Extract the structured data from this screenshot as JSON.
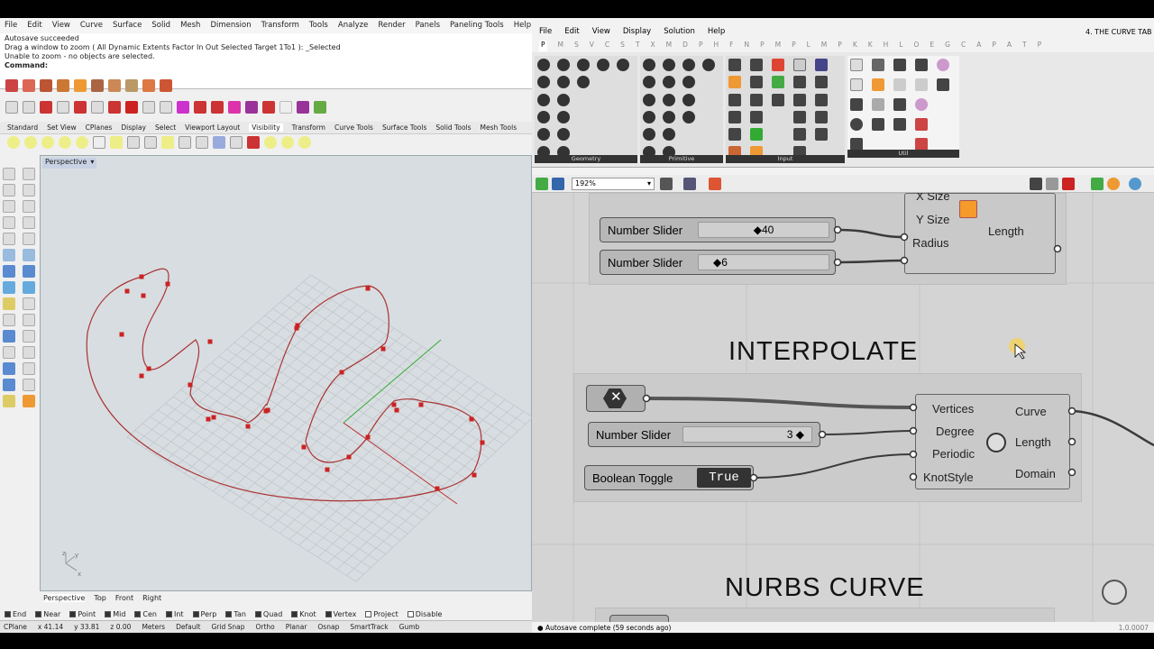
{
  "rhino": {
    "menu": [
      "File",
      "Edit",
      "View",
      "Curve",
      "Surface",
      "Solid",
      "Mesh",
      "Dimension",
      "Transform",
      "Tools",
      "Analyze",
      "Render",
      "Panels",
      "Paneling Tools",
      "Help"
    ],
    "history": [
      "Autosave succeeded",
      "Drag a window to zoom ( All  Dynamic  Extents  Factor  In  Out  Selected  Target  1To1 ): _Selected",
      "Unable to zoom - no objects are selected."
    ],
    "command_label": "Command:",
    "toolbar_tabs": [
      "Standard",
      "Set View",
      "CPlanes",
      "Display",
      "Select",
      "Viewport Layout",
      "Visibility",
      "Transform",
      "Curve Tools",
      "Surface Tools",
      "Solid Tools",
      "Mesh Tools"
    ],
    "active_tab": "Visibility",
    "viewport_title": "Perspective",
    "viewport_tabs": [
      "Perspective",
      "Top",
      "Front",
      "Right"
    ],
    "axis_labels": [
      "z",
      "y",
      "x"
    ],
    "osnaps": [
      {
        "label": "End",
        "checked": true
      },
      {
        "label": "Near",
        "checked": true
      },
      {
        "label": "Point",
        "checked": true
      },
      {
        "label": "Mid",
        "checked": true
      },
      {
        "label": "Cen",
        "checked": true
      },
      {
        "label": "Int",
        "checked": true
      },
      {
        "label": "Perp",
        "checked": true
      },
      {
        "label": "Tan",
        "checked": true
      },
      {
        "label": "Quad",
        "checked": true
      },
      {
        "label": "Knot",
        "checked": true
      },
      {
        "label": "Vertex",
        "checked": true
      },
      {
        "label": "Project",
        "checked": false
      },
      {
        "label": "Disable",
        "checked": false
      }
    ],
    "status": [
      "CPlane",
      "x 41.14",
      "y 33.81",
      "z 0.00",
      "Meters",
      "Default",
      "Grid Snap",
      "Ortho",
      "Planar",
      "Osnap",
      "SmartTrack",
      "Gumb"
    ]
  },
  "gh": {
    "title": "4. THE CURVE TAB",
    "menu": [
      "File",
      "Edit",
      "View",
      "Display",
      "Solution",
      "Help"
    ],
    "tabs": [
      "P",
      "M",
      "S",
      "V",
      "C",
      "S",
      "T",
      "X",
      "M",
      "D",
      "P",
      "H",
      "F",
      "N",
      "P",
      "M",
      "P",
      "L",
      "M",
      "P",
      "K",
      "K",
      "H",
      "L",
      "O",
      "E",
      "G",
      "C",
      "A",
      "P",
      "A",
      "T",
      "P"
    ],
    "ribbon_groups": [
      "Geometry",
      "Primitive",
      "Input",
      "Util"
    ],
    "zoom": "192%",
    "canvas": {
      "top_sliders": [
        {
          "label": "Number Slider",
          "value": "40"
        },
        {
          "label": "Number Slider",
          "value": "6"
        }
      ],
      "top_inputs": [
        "X Size",
        "Y Size",
        "Radius"
      ],
      "top_output": "Length",
      "interpolate_title": "INTERPOLATE",
      "degree_slider": {
        "label": "Number Slider",
        "value": "3"
      },
      "toggle": {
        "label": "Boolean Toggle",
        "value": "True"
      },
      "inputs": [
        "Vertices",
        "Degree",
        "Periodic",
        "KnotStyle"
      ],
      "outputs": [
        "Curve",
        "Length",
        "Domain"
      ],
      "nurbs_title": "NURBS CURVE"
    },
    "status_text": "Autosave complete (59 seconds ago)",
    "version": "1.0.0007"
  }
}
